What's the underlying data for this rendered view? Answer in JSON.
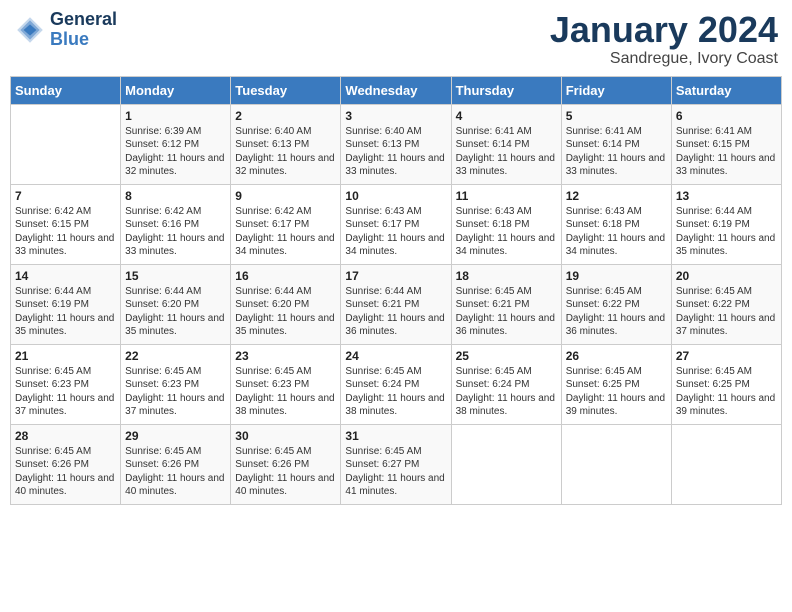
{
  "header": {
    "logo_line1": "General",
    "logo_line2": "Blue",
    "title": "January 2024",
    "subtitle": "Sandregue, Ivory Coast"
  },
  "days_of_week": [
    "Sunday",
    "Monday",
    "Tuesday",
    "Wednesday",
    "Thursday",
    "Friday",
    "Saturday"
  ],
  "weeks": [
    [
      {
        "day": "",
        "content": ""
      },
      {
        "day": "1",
        "content": "Sunrise: 6:39 AM\nSunset: 6:12 PM\nDaylight: 11 hours\nand 32 minutes."
      },
      {
        "day": "2",
        "content": "Sunrise: 6:40 AM\nSunset: 6:13 PM\nDaylight: 11 hours\nand 32 minutes."
      },
      {
        "day": "3",
        "content": "Sunrise: 6:40 AM\nSunset: 6:13 PM\nDaylight: 11 hours\nand 33 minutes."
      },
      {
        "day": "4",
        "content": "Sunrise: 6:41 AM\nSunset: 6:14 PM\nDaylight: 11 hours\nand 33 minutes."
      },
      {
        "day": "5",
        "content": "Sunrise: 6:41 AM\nSunset: 6:14 PM\nDaylight: 11 hours\nand 33 minutes."
      },
      {
        "day": "6",
        "content": "Sunrise: 6:41 AM\nSunset: 6:15 PM\nDaylight: 11 hours\nand 33 minutes."
      }
    ],
    [
      {
        "day": "7",
        "content": "Sunrise: 6:42 AM\nSunset: 6:15 PM\nDaylight: 11 hours\nand 33 minutes."
      },
      {
        "day": "8",
        "content": "Sunrise: 6:42 AM\nSunset: 6:16 PM\nDaylight: 11 hours\nand 33 minutes."
      },
      {
        "day": "9",
        "content": "Sunrise: 6:42 AM\nSunset: 6:17 PM\nDaylight: 11 hours\nand 34 minutes."
      },
      {
        "day": "10",
        "content": "Sunrise: 6:43 AM\nSunset: 6:17 PM\nDaylight: 11 hours\nand 34 minutes."
      },
      {
        "day": "11",
        "content": "Sunrise: 6:43 AM\nSunset: 6:18 PM\nDaylight: 11 hours\nand 34 minutes."
      },
      {
        "day": "12",
        "content": "Sunrise: 6:43 AM\nSunset: 6:18 PM\nDaylight: 11 hours\nand 34 minutes."
      },
      {
        "day": "13",
        "content": "Sunrise: 6:44 AM\nSunset: 6:19 PM\nDaylight: 11 hours\nand 35 minutes."
      }
    ],
    [
      {
        "day": "14",
        "content": "Sunrise: 6:44 AM\nSunset: 6:19 PM\nDaylight: 11 hours\nand 35 minutes."
      },
      {
        "day": "15",
        "content": "Sunrise: 6:44 AM\nSunset: 6:20 PM\nDaylight: 11 hours\nand 35 minutes."
      },
      {
        "day": "16",
        "content": "Sunrise: 6:44 AM\nSunset: 6:20 PM\nDaylight: 11 hours\nand 35 minutes."
      },
      {
        "day": "17",
        "content": "Sunrise: 6:44 AM\nSunset: 6:21 PM\nDaylight: 11 hours\nand 36 minutes."
      },
      {
        "day": "18",
        "content": "Sunrise: 6:45 AM\nSunset: 6:21 PM\nDaylight: 11 hours\nand 36 minutes."
      },
      {
        "day": "19",
        "content": "Sunrise: 6:45 AM\nSunset: 6:22 PM\nDaylight: 11 hours\nand 36 minutes."
      },
      {
        "day": "20",
        "content": "Sunrise: 6:45 AM\nSunset: 6:22 PM\nDaylight: 11 hours\nand 37 minutes."
      }
    ],
    [
      {
        "day": "21",
        "content": "Sunrise: 6:45 AM\nSunset: 6:23 PM\nDaylight: 11 hours\nand 37 minutes."
      },
      {
        "day": "22",
        "content": "Sunrise: 6:45 AM\nSunset: 6:23 PM\nDaylight: 11 hours\nand 37 minutes."
      },
      {
        "day": "23",
        "content": "Sunrise: 6:45 AM\nSunset: 6:23 PM\nDaylight: 11 hours\nand 38 minutes."
      },
      {
        "day": "24",
        "content": "Sunrise: 6:45 AM\nSunset: 6:24 PM\nDaylight: 11 hours\nand 38 minutes."
      },
      {
        "day": "25",
        "content": "Sunrise: 6:45 AM\nSunset: 6:24 PM\nDaylight: 11 hours\nand 38 minutes."
      },
      {
        "day": "26",
        "content": "Sunrise: 6:45 AM\nSunset: 6:25 PM\nDaylight: 11 hours\nand 39 minutes."
      },
      {
        "day": "27",
        "content": "Sunrise: 6:45 AM\nSunset: 6:25 PM\nDaylight: 11 hours\nand 39 minutes."
      }
    ],
    [
      {
        "day": "28",
        "content": "Sunrise: 6:45 AM\nSunset: 6:26 PM\nDaylight: 11 hours\nand 40 minutes."
      },
      {
        "day": "29",
        "content": "Sunrise: 6:45 AM\nSunset: 6:26 PM\nDaylight: 11 hours\nand 40 minutes."
      },
      {
        "day": "30",
        "content": "Sunrise: 6:45 AM\nSunset: 6:26 PM\nDaylight: 11 hours\nand 40 minutes."
      },
      {
        "day": "31",
        "content": "Sunrise: 6:45 AM\nSunset: 6:27 PM\nDaylight: 11 hours\nand 41 minutes."
      },
      {
        "day": "",
        "content": ""
      },
      {
        "day": "",
        "content": ""
      },
      {
        "day": "",
        "content": ""
      }
    ]
  ]
}
